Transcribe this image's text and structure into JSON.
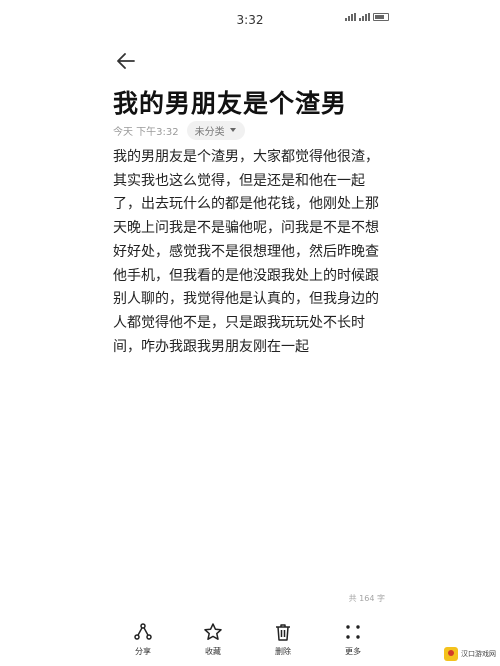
{
  "status_bar": {
    "time": "3:32",
    "indicators": [
      "signal-icon",
      "signal-icon",
      "battery-icon"
    ],
    "battery_label": "80"
  },
  "note": {
    "title": "我的男朋友是个渣男",
    "date": "今天 下午3:32",
    "category": "未分类",
    "body_lines": [
      "我的男朋友是个渣男，大家都觉得他很渣，",
      "其实我也这么觉得，但是还是和他在一起",
      "了，出去玩什么的都是他花钱，他刚处上那",
      "天晚上问我是不是骗他呢，问我是不是不想",
      "好好处，感觉我不是很想理他，然后昨晚查",
      "他手机，但我看的是他没跟我处上的时候跟",
      "别人聊的，我觉得他是认真的，但我身边的",
      "人都觉得他不是，只是跟我玩玩处不长时",
      "间，咋办我跟我男朋友刚在一起"
    ],
    "word_count": "共 164 字"
  },
  "toolbar": {
    "items": [
      {
        "label": "分享",
        "icon": "share-icon"
      },
      {
        "label": "收藏",
        "icon": "star-icon"
      },
      {
        "label": "删除",
        "icon": "trash-icon"
      },
      {
        "label": "更多",
        "icon": "more-icon"
      }
    ]
  },
  "watermark": {
    "text": "汉口游戏网"
  }
}
